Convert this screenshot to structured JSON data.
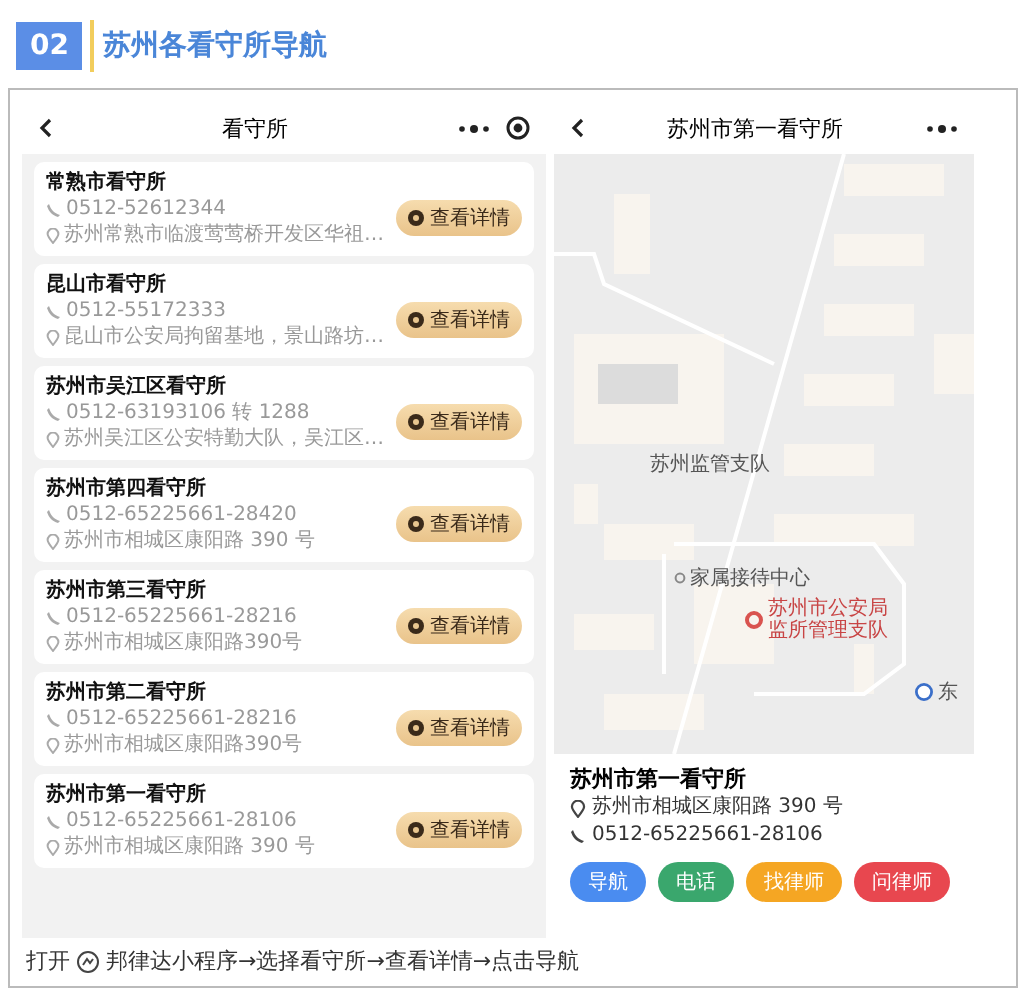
{
  "section": {
    "number": "02",
    "title": "苏州各看守所导航"
  },
  "list_screen": {
    "title": "看守所",
    "items": [
      {
        "name": "常熟市看守所",
        "phone": "0512-52612344",
        "address": "苏州常熟市临渡莺莺桥开发区华祖…",
        "button": "查看详情"
      },
      {
        "name": "昆山市看守所",
        "phone": "0512-55172333",
        "address": "昆山市公安局拘留基地，景山路坊…",
        "button": "查看详情"
      },
      {
        "name": "苏州市吴江区看守所",
        "phone": "0512-63193106 转 1288",
        "address": "苏州吴江区公安特勤大队，吴江区…",
        "button": "查看详情"
      },
      {
        "name": "苏州市第四看守所",
        "phone": "0512-65225661-28420",
        "address": "苏州市相城区康阳路 390 号",
        "button": "查看详情"
      },
      {
        "name": "苏州市第三看守所",
        "phone": "0512-65225661-28216",
        "address": "苏州市相城区康阳路390号",
        "button": "查看详情"
      },
      {
        "name": "苏州市第二看守所",
        "phone": "0512-65225661-28216",
        "address": "苏州市相城区康阳路390号",
        "button": "查看详情"
      },
      {
        "name": "苏州市第一看守所",
        "phone": "0512-65225661-28106",
        "address": "苏州市相城区康阳路 390 号",
        "button": "查看详情"
      }
    ]
  },
  "detail_screen": {
    "title": "苏州市第一看守所",
    "map_labels": [
      {
        "kind": "plain",
        "text": "苏州监管支队"
      },
      {
        "kind": "dot",
        "text": "家属接待中心"
      },
      {
        "kind": "pin",
        "text": "苏州市公安局监所管理支队"
      },
      {
        "kind": "circle",
        "text": "东"
      }
    ],
    "name": "苏州市第一看守所",
    "address": "苏州市相城区康阳路 390 号",
    "phone": "0512-65225661-28106",
    "actions": [
      {
        "label": "导航",
        "color": "#4a8cf0"
      },
      {
        "label": "电话",
        "color": "#3aa76d"
      },
      {
        "label": "找律师",
        "color": "#f5a623"
      },
      {
        "label": "问律师",
        "color": "#e8474f"
      }
    ]
  },
  "caption": {
    "before": "打开",
    "after": "邦律达小程序→选择看守所→查看详情→点击导航"
  }
}
